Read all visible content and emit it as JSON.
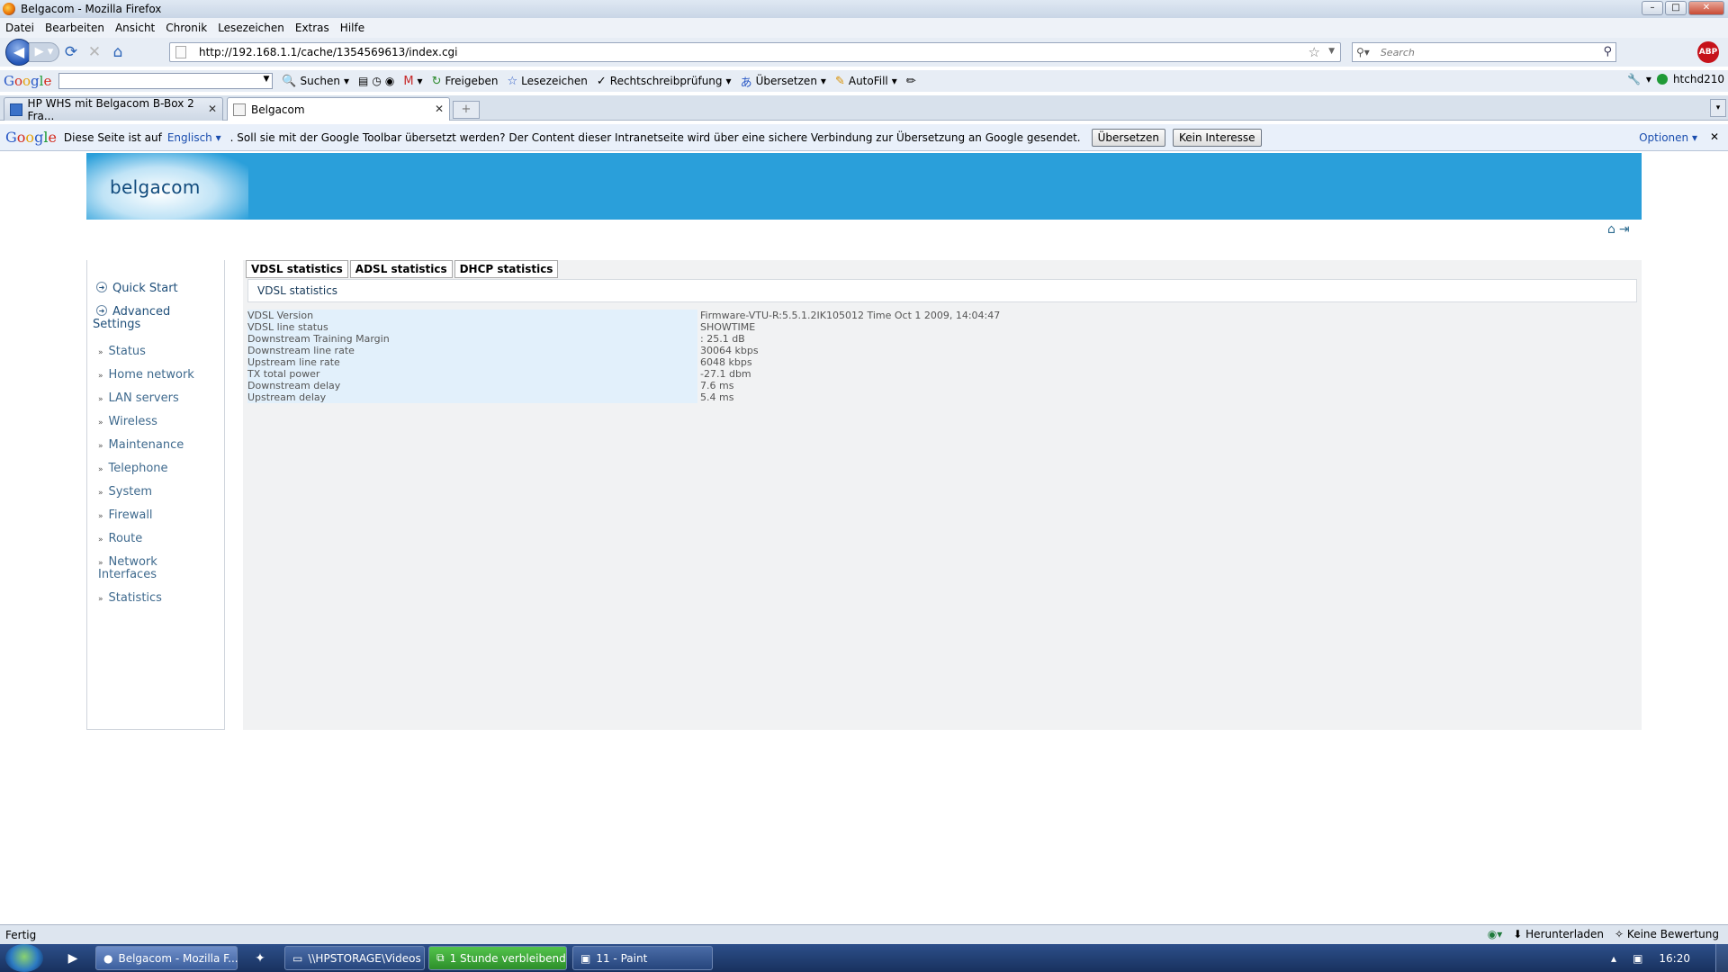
{
  "window": {
    "title": "Belgacom - Mozilla Firefox"
  },
  "menu": [
    "Datei",
    "Bearbeiten",
    "Ansicht",
    "Chronik",
    "Lesezeichen",
    "Extras",
    "Hilfe"
  ],
  "nav": {
    "url": "http://192.168.1.1/cache/1354569613/index.cgi",
    "search_placeholder": "Search",
    "addon_badge": "ABP"
  },
  "google_toolbar": {
    "logo": "Google",
    "items": [
      "Suchen",
      "Freigeben",
      "Lesezeichen",
      "Rechtschreibprüfung",
      "Übersetzen",
      "AutoFill"
    ],
    "user": "htchd210"
  },
  "tabs": [
    {
      "label": "HP WHS mit Belgacom B-Box 2 Fra...",
      "active": false
    },
    {
      "label": "Belgacom",
      "active": true
    }
  ],
  "translate_bar": {
    "logo": "Google",
    "msg_pre": "Diese Seite ist auf",
    "language": "Englisch",
    "msg_post": ". Soll sie mit der Google Toolbar übersetzt werden? Der Content dieser Intranetseite wird über eine sichere Verbindung zur Übersetzung an Google gesendet.",
    "translate_btn": "Übersetzen",
    "no_interest_btn": "Kein Interesse",
    "options": "Optionen",
    "options_arrow": "▾"
  },
  "banner": {
    "logo": "belgacom",
    "color": "#2a9fda"
  },
  "sidebar": {
    "quick_start": "Quick Start",
    "advanced_line1": "Advanced",
    "advanced_line2": "Settings",
    "items": [
      "Status",
      "Home network",
      "LAN servers",
      "Wireless",
      "Maintenance",
      "Telephone",
      "System",
      "Firewall",
      "Route",
      "Network",
      "Statistics"
    ],
    "network_interfaces_line2": "Interfaces"
  },
  "content": {
    "tabs": [
      "VDSL statistics",
      "ADSL statistics",
      "DHCP statistics"
    ],
    "panel_title": "VDSL statistics",
    "rows": [
      {
        "label": "VDSL Version",
        "value": "Firmware-VTU-R:5.5.1.2IK105012 Time Oct 1 2009, 14:04:47"
      },
      {
        "label": "VDSL line status",
        "value": "SHOWTIME"
      },
      {
        "label": "Downstream Training Margin",
        "value": ": 25.1 dB"
      },
      {
        "label": "Downstream line rate",
        "value": "30064 kbps"
      },
      {
        "label": "Upstream line rate",
        "value": "6048 kbps"
      },
      {
        "label": "TX total power",
        "value": "-27.1 dbm"
      },
      {
        "label": "Downstream delay",
        "value": "7.6 ms"
      },
      {
        "label": "Upstream delay",
        "value": "5.4 ms"
      }
    ]
  },
  "statusbar": {
    "status": "Fertig",
    "download": "Herunterladen",
    "rating": "Keine Bewertung"
  },
  "taskbar": {
    "buttons": [
      "Belgacom - Mozilla F...",
      "\\\\HPSTORAGE\\Videos",
      "1 Stunde verbleibend",
      "11 - Paint"
    ],
    "clock": "16:20"
  }
}
